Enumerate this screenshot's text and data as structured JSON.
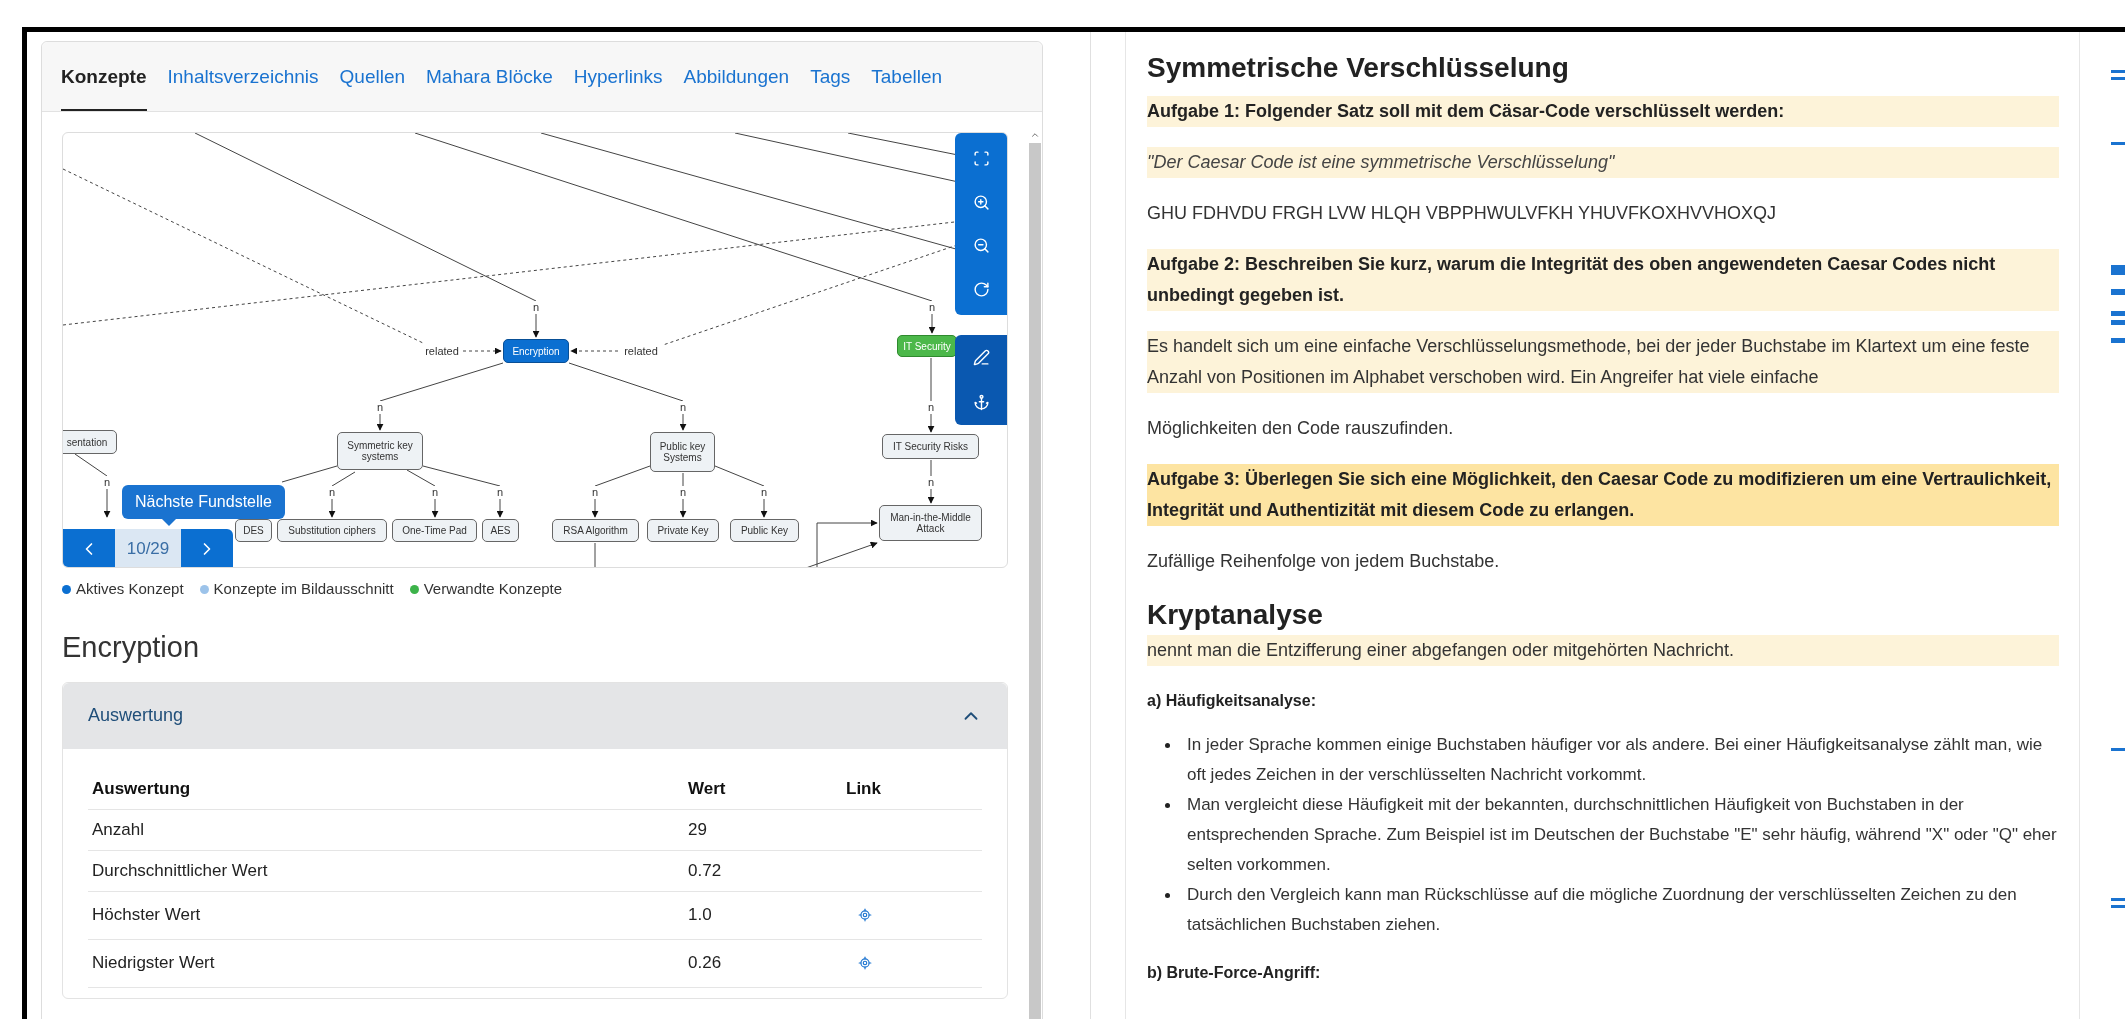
{
  "tabs": [
    {
      "label": "Konzepte",
      "selected": true
    },
    {
      "label": "Inhaltsverzeichnis",
      "selected": false
    },
    {
      "label": "Quellen",
      "selected": false
    },
    {
      "label": "Mahara Blöcke",
      "selected": false
    },
    {
      "label": "Hyperlinks",
      "selected": false
    },
    {
      "label": "Abbildungen",
      "selected": false
    },
    {
      "label": "Tags",
      "selected": false
    },
    {
      "label": "Tabellen",
      "selected": false
    }
  ],
  "graph": {
    "nodes": [
      {
        "label": "Encryption",
        "kind": "active"
      },
      {
        "label": "IT Security",
        "kind": "related"
      },
      {
        "label": "sentation",
        "kind": "concept"
      },
      {
        "label": "Symmetric key systems",
        "kind": "concept"
      },
      {
        "label": "Public key Systems",
        "kind": "concept"
      },
      {
        "label": "IT Security Risks",
        "kind": "concept"
      },
      {
        "label": "DES",
        "kind": "concept"
      },
      {
        "label": "Substitution ciphers",
        "kind": "concept"
      },
      {
        "label": "One-Time Pad",
        "kind": "concept"
      },
      {
        "label": "AES",
        "kind": "concept"
      },
      {
        "label": "RSA Algorithm",
        "kind": "concept"
      },
      {
        "label": "Private Key",
        "kind": "concept"
      },
      {
        "label": "Public Key",
        "kind": "concept"
      },
      {
        "label": "Man-in-the-Middle Attack",
        "kind": "concept"
      }
    ],
    "edge_labels": [
      "related",
      "related",
      "n",
      "n",
      "n",
      "n",
      "n",
      "n",
      "n",
      "n",
      "n",
      "n",
      "n",
      "n",
      "n"
    ],
    "tooltip": "Nächste Fundstelle",
    "position": "10/29"
  },
  "legend": [
    {
      "label": "Aktives Konzept",
      "color": "#0b6fd1"
    },
    {
      "label": "Konzepte im Bildausschnitt",
      "color": "#9cc3ea"
    },
    {
      "label": "Verwandte Konzepte",
      "color": "#3cb34a"
    }
  ],
  "concept_title": "Encryption",
  "accordion": {
    "title": "Auswertung",
    "expanded": true,
    "columns": [
      "Auswertung",
      "Wert",
      "Link"
    ],
    "rows": [
      {
        "label": "Anzahl",
        "value": "29",
        "link": false
      },
      {
        "label": "Durchschnittlicher Wert",
        "value": "0.72",
        "link": false
      },
      {
        "label": "Höchster Wert",
        "value": "1.0",
        "link": true
      },
      {
        "label": "Niedrigster Wert",
        "value": "0.26",
        "link": true
      }
    ]
  },
  "document": [
    {
      "kind": "heading",
      "text": "Symmetrische Verschlüsselung"
    },
    {
      "kind": "task",
      "text": "Aufgabe 1: Folgender Satz soll mit dem Cäsar-Code verschlüsselt werden:",
      "color": "#fdf3d9"
    },
    {
      "kind": "quote",
      "text": "\"Der Caesar Code ist eine symmetrische Verschlüsselung\"",
      "color": "#fdf3d9"
    },
    {
      "kind": "text",
      "text": "GHU FDHVDU FRGH LVW HLQH VBPPHWULVFKH YHUVFKOXHVVHOXQJ"
    },
    {
      "kind": "task",
      "text": "Aufgabe 2: Beschreiben Sie kurz, warum die Integrität des oben angewendeten Caesar Codes nicht unbedingt gegeben ist.",
      "color": "#fdf3d9"
    },
    {
      "kind": "text",
      "text": "Es handelt sich um eine einfache Verschlüsselungsmethode, bei der jeder Buchstabe im Klartext um eine feste Anzahl von Positionen im Alphabet verschoben wird. Ein Angreifer hat viele einfache",
      "color": "#fdf3d9"
    },
    {
      "kind": "text",
      "text": "Möglichkeiten den Code rauszufinden."
    },
    {
      "kind": "task",
      "text": "Aufgabe 3: Überlegen Sie sich eine Möglichkeit, den Caesar Code zu modifizieren um eine Vertraulichkeit, Integrität und Authentizität mit diesem Code zu erlangen.",
      "color": "#fde4a2"
    },
    {
      "kind": "text",
      "text": "Zufällige Reihenfolge von jedem Buchstabe."
    },
    {
      "kind": "heading",
      "text": "Kryptanalyse"
    },
    {
      "kind": "text",
      "text": "nennt man die Entzifferung einer abgefangen oder mitgehörten Nachricht.",
      "color": "#fdf3d9"
    },
    {
      "kind": "subheading",
      "text": "a) Häufigkeitsanalyse:"
    },
    {
      "kind": "bullets",
      "items": [
        "In jeder Sprache kommen einige Buchstaben häufiger vor als andere. Bei einer Häufigkeitsanalyse zählt man, wie oft jedes Zeichen in der verschlüsselten Nachricht vorkommt.",
        "Man vergleicht diese Häufigkeit mit der bekannten, durchschnittlichen Häufigkeit von Buchstaben in der entsprechenden Sprache. Zum Beispiel ist im Deutschen der Buchstabe \"E\" sehr häufig, während \"X\" oder \"Q\" eher selten vorkommen.",
        "Durch den Vergleich kann man Rückschlüsse auf die mögliche Zuordnung der verschlüsselten Zeichen zu den tatsächlichen Buchstaben ziehen."
      ]
    },
    {
      "kind": "subheading",
      "text": "b) Brute-Force-Angriff:"
    }
  ]
}
